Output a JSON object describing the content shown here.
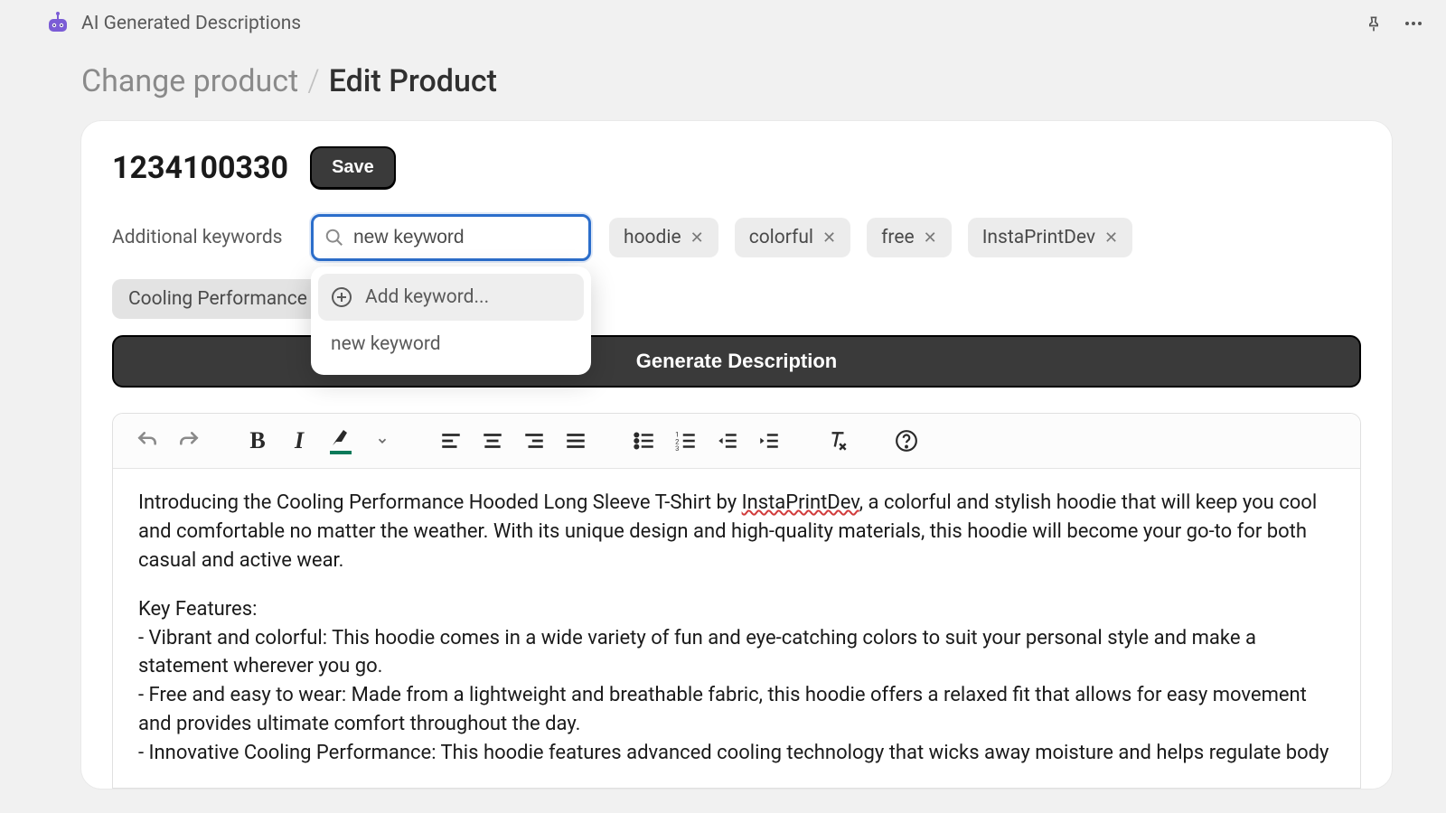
{
  "header": {
    "app_title": "AI Generated Descriptions"
  },
  "breadcrumb": {
    "previous": "Change product",
    "separator": "/",
    "current": "Edit Product"
  },
  "product": {
    "id": "1234100330",
    "save_label": "Save"
  },
  "keywords": {
    "label": "Additional keywords",
    "input_value": "new keyword",
    "dropdown": {
      "add_label": "Add keyword...",
      "suggestion": "new keyword"
    },
    "chips": [
      "hoodie",
      "colorful",
      "free",
      "InstaPrintDev"
    ],
    "truncated_chip": "Cooling Performance Ho"
  },
  "actions": {
    "generate_label": "Generate Description"
  },
  "editor": {
    "paragraph_pre": "Introducing the Cooling Performance Hooded Long Sleeve T-Shirt by ",
    "spell_word": "InstaPrintDev",
    "paragraph_post": ", a colorful and stylish hoodie that will keep you cool and comfortable no matter the weather. With its unique design and high-quality materials, this hoodie will become your go-to for both casual and active wear.",
    "features_heading": "Key Features:",
    "bullets": [
      "- Vibrant and colorful: This hoodie comes in a wide variety of fun and eye-catching colors to suit your personal style and make a statement wherever you go.",
      "- Free and easy to wear: Made from a lightweight and breathable fabric, this hoodie offers a relaxed fit that allows for easy movement and provides ultimate comfort throughout the day.",
      "- Innovative Cooling Performance: This hoodie features advanced cooling technology that wicks away moisture and helps regulate body"
    ]
  }
}
